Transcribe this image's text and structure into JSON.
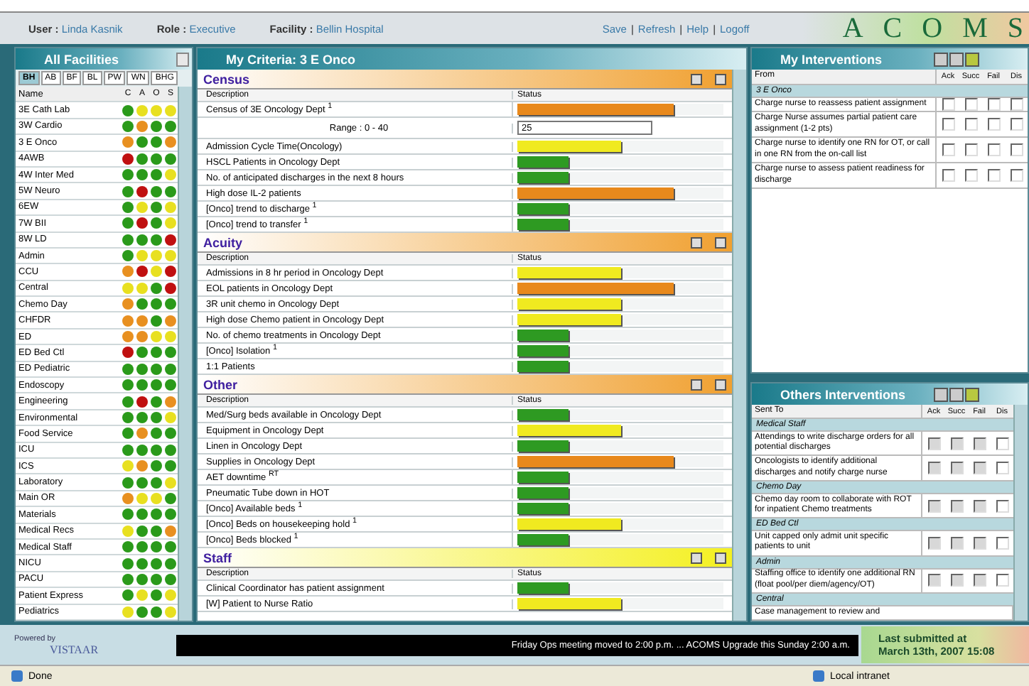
{
  "header": {
    "user_label": "User :",
    "user": "Linda Kasnik",
    "role_label": "Role :",
    "role": "Executive",
    "facility_label": "Facility :",
    "facility": "Bellin Hospital",
    "links": [
      "Save",
      "Refresh",
      "Help",
      "Logoff"
    ],
    "separator": "|",
    "logo": [
      "A",
      "C",
      "O",
      "M",
      "S"
    ]
  },
  "facilities": {
    "title": "All Facilities",
    "tabs": [
      {
        "label": "BH",
        "selected": true
      },
      {
        "label": "AB",
        "selected": false
      },
      {
        "label": "BF",
        "selected": false
      },
      {
        "label": "BL",
        "selected": false
      },
      {
        "label": "PW",
        "selected": false
      },
      {
        "label": "WN",
        "selected": false
      },
      {
        "label": "BHG",
        "selected": false
      }
    ],
    "columns": [
      "Name",
      "C",
      "A",
      "O",
      "S"
    ],
    "rows": [
      {
        "name": "3E Cath Lab",
        "lights": [
          {
            "color": "#2a9a1a"
          },
          {
            "color": "#e8e020"
          },
          {
            "color": "#e8e020"
          },
          {
            "color": "#e8e020"
          }
        ]
      },
      {
        "name": "3W Cardio",
        "lights": [
          {
            "color": "#2a9a1a"
          },
          {
            "color": "#e89020"
          },
          {
            "color": "#2a9a1a"
          },
          {
            "color": "#2a9a1a"
          }
        ]
      },
      {
        "name": "3 E Onco",
        "lights": [
          {
            "color": "#e89020"
          },
          {
            "color": "#2a9a1a"
          },
          {
            "color": "#2a9a1a"
          },
          {
            "color": "#e89020"
          }
        ]
      },
      {
        "name": "4AWB",
        "lights": [
          {
            "color": "#c01010"
          },
          {
            "color": "#2a9a1a"
          },
          {
            "color": "#2a9a1a"
          },
          {
            "color": "#2a9a1a"
          }
        ]
      },
      {
        "name": "4W Inter Med",
        "lights": [
          {
            "color": "#2a9a1a"
          },
          {
            "color": "#2a9a1a"
          },
          {
            "color": "#2a9a1a"
          },
          {
            "color": "#e8e020"
          }
        ]
      },
      {
        "name": "5W Neuro",
        "lights": [
          {
            "color": "#2a9a1a"
          },
          {
            "color": "#c01010"
          },
          {
            "color": "#2a9a1a"
          },
          {
            "color": "#2a9a1a"
          }
        ]
      },
      {
        "name": "6EW",
        "lights": [
          {
            "color": "#2a9a1a"
          },
          {
            "color": "#e8e020"
          },
          {
            "color": "#2a9a1a"
          },
          {
            "color": "#e8e020"
          }
        ]
      },
      {
        "name": "7W BII",
        "lights": [
          {
            "color": "#2a9a1a"
          },
          {
            "color": "#c01010"
          },
          {
            "color": "#2a9a1a"
          },
          {
            "color": "#e8e020"
          }
        ]
      },
      {
        "name": "8W LD",
        "lights": [
          {
            "color": "#2a9a1a"
          },
          {
            "color": "#2a9a1a"
          },
          {
            "color": "#2a9a1a"
          },
          {
            "color": "#c01010"
          }
        ]
      },
      {
        "name": "Admin",
        "lights": [
          {
            "color": "#2a9a1a"
          },
          {
            "color": "#e8e020"
          },
          {
            "color": "#e8e020"
          },
          {
            "color": "#e8e020"
          }
        ]
      },
      {
        "name": "CCU",
        "lights": [
          {
            "color": "#e89020"
          },
          {
            "color": "#c01010"
          },
          {
            "color": "#e8e020"
          },
          {
            "color": "#c01010"
          }
        ]
      },
      {
        "name": "Central",
        "lights": [
          {
            "color": "#e8e020"
          },
          {
            "color": "#e8e020"
          },
          {
            "color": "#2a9a1a"
          },
          {
            "color": "#c01010"
          }
        ]
      },
      {
        "name": "Chemo Day",
        "lights": [
          {
            "color": "#e89020"
          },
          {
            "color": "#2a9a1a"
          },
          {
            "color": "#2a9a1a"
          },
          {
            "color": "#2a9a1a"
          }
        ]
      },
      {
        "name": "CHFDR",
        "lights": [
          {
            "color": "#e89020"
          },
          {
            "color": "#e89020"
          },
          {
            "color": "#2a9a1a"
          },
          {
            "color": "#e89020"
          }
        ]
      },
      {
        "name": "ED",
        "lights": [
          {
            "color": "#e89020"
          },
          {
            "color": "#e89020"
          },
          {
            "color": "#e8e020"
          },
          {
            "color": "#e8e020"
          }
        ]
      },
      {
        "name": "ED Bed Ctl",
        "lights": [
          {
            "color": "#c01010"
          },
          {
            "color": "#2a9a1a"
          },
          {
            "color": "#2a9a1a"
          },
          {
            "color": "#2a9a1a"
          }
        ]
      },
      {
        "name": "ED Pediatric",
        "lights": [
          {
            "color": "#2a9a1a"
          },
          {
            "color": "#2a9a1a"
          },
          {
            "color": "#2a9a1a"
          },
          {
            "color": "#2a9a1a"
          }
        ]
      },
      {
        "name": "Endoscopy",
        "lights": [
          {
            "color": "#2a9a1a"
          },
          {
            "color": "#2a9a1a"
          },
          {
            "color": "#2a9a1a"
          },
          {
            "color": "#2a9a1a"
          }
        ]
      },
      {
        "name": "Engineering",
        "lights": [
          {
            "color": "#2a9a1a"
          },
          {
            "color": "#c01010"
          },
          {
            "color": "#2a9a1a"
          },
          {
            "color": "#e89020"
          }
        ]
      },
      {
        "name": "Environmental",
        "lights": [
          {
            "color": "#2a9a1a"
          },
          {
            "color": "#2a9a1a"
          },
          {
            "color": "#2a9a1a"
          },
          {
            "color": "#e8e020"
          }
        ]
      },
      {
        "name": "Food Service",
        "lights": [
          {
            "color": "#2a9a1a"
          },
          {
            "color": "#e89020"
          },
          {
            "color": "#2a9a1a"
          },
          {
            "color": "#2a9a1a"
          }
        ]
      },
      {
        "name": "ICU",
        "lights": [
          {
            "color": "#2a9a1a"
          },
          {
            "color": "#2a9a1a"
          },
          {
            "color": "#2a9a1a"
          },
          {
            "color": "#2a9a1a"
          }
        ]
      },
      {
        "name": "ICS",
        "lights": [
          {
            "color": "#e8e020"
          },
          {
            "color": "#e89020"
          },
          {
            "color": "#2a9a1a"
          },
          {
            "color": "#2a9a1a"
          }
        ]
      },
      {
        "name": "Laboratory",
        "lights": [
          {
            "color": "#2a9a1a"
          },
          {
            "color": "#2a9a1a"
          },
          {
            "color": "#2a9a1a"
          },
          {
            "color": "#e8e020"
          }
        ]
      },
      {
        "name": "Main OR",
        "lights": [
          {
            "color": "#e89020"
          },
          {
            "color": "#e8e020"
          },
          {
            "color": "#e8e020"
          },
          {
            "color": "#2a9a1a"
          }
        ]
      },
      {
        "name": "Materials",
        "lights": [
          {
            "color": "#2a9a1a"
          },
          {
            "color": "#2a9a1a"
          },
          {
            "color": "#2a9a1a"
          },
          {
            "color": "#2a9a1a"
          }
        ]
      },
      {
        "name": "Medical Recs",
        "lights": [
          {
            "color": "#e8e020"
          },
          {
            "color": "#2a9a1a"
          },
          {
            "color": "#2a9a1a"
          },
          {
            "color": "#e89020"
          }
        ]
      },
      {
        "name": "Medical Staff",
        "lights": [
          {
            "color": "#2a9a1a"
          },
          {
            "color": "#2a9a1a"
          },
          {
            "color": "#2a9a1a"
          },
          {
            "color": "#2a9a1a"
          }
        ]
      },
      {
        "name": "NICU",
        "lights": [
          {
            "color": "#2a9a1a"
          },
          {
            "color": "#2a9a1a"
          },
          {
            "color": "#2a9a1a"
          },
          {
            "color": "#2a9a1a"
          }
        ]
      },
      {
        "name": "PACU",
        "lights": [
          {
            "color": "#2a9a1a"
          },
          {
            "color": "#2a9a1a"
          },
          {
            "color": "#2a9a1a"
          },
          {
            "color": "#2a9a1a"
          }
        ]
      },
      {
        "name": "Patient Express",
        "lights": [
          {
            "color": "#2a9a1a"
          },
          {
            "color": "#e8e020"
          },
          {
            "color": "#2a9a1a"
          },
          {
            "color": "#e8e020"
          }
        ]
      },
      {
        "name": "Pediatrics",
        "lights": [
          {
            "color": "#e8e020"
          },
          {
            "color": "#2a9a1a"
          },
          {
            "color": "#2a9a1a"
          },
          {
            "color": "#e8e020"
          }
        ]
      }
    ]
  },
  "criteria": {
    "title": "My Criteria: 3 E Onco",
    "sections": [
      {
        "name": "Census",
        "color": "#f0a030",
        "columns": [
          "Description",
          "Status"
        ],
        "rows": [
          {
            "kind": "bar",
            "label": "Census of 3E Oncology Dept $^{1}$",
            "level": 0.76,
            "color": "#e8891c"
          },
          {
            "kind": "range",
            "label": "Range : 0 - 40",
            "value": "25"
          },
          {
            "kind": "bar",
            "label": "Admission Cycle Time(Oncology)",
            "level": 0.5,
            "color": "#f0ea20"
          },
          {
            "kind": "bar",
            "label": "HSCL Patients in Oncology Dept",
            "level": 0.25,
            "color": "#2e9a22"
          },
          {
            "kind": "bar",
            "label": "No. of anticipated discharges in the next 8 hours",
            "level": 0.25,
            "color": "#2e9a22"
          },
          {
            "kind": "bar",
            "label": "High dose IL-2 patients",
            "level": 0.76,
            "color": "#e8891c"
          },
          {
            "kind": "bar",
            "label": "[Onco] trend to discharge $^{1}$",
            "level": 0.25,
            "color": "#2e9a22"
          },
          {
            "kind": "bar",
            "label": "[Onco] trend to transfer $^{1}$",
            "level": 0.25,
            "color": "#2e9a22"
          }
        ]
      },
      {
        "name": "Acuity",
        "color": "#f0a030",
        "columns": [
          "Description",
          "Status"
        ],
        "rows": [
          {
            "kind": "bar",
            "label": "Admissions in 8 hr period in Oncology Dept",
            "level": 0.5,
            "color": "#f0ea20"
          },
          {
            "kind": "bar",
            "label": "EOL patients in Oncology Dept",
            "level": 0.76,
            "color": "#e8891c"
          },
          {
            "kind": "bar",
            "label": "3R unit chemo in Oncology Dept",
            "level": 0.5,
            "color": "#f0ea20"
          },
          {
            "kind": "bar",
            "label": "High dose Chemo patient in Oncology Dept",
            "level": 0.5,
            "color": "#f0ea20"
          },
          {
            "kind": "bar",
            "label": "No. of chemo treatments in Oncology Dept",
            "level": 0.25,
            "color": "#2e9a22"
          },
          {
            "kind": "bar",
            "label": "[Onco] Isolation $^{1}$",
            "level": 0.25,
            "color": "#2e9a22"
          },
          {
            "kind": "bar",
            "label": "1:1 Patients",
            "level": 0.25,
            "color": "#2e9a22"
          }
        ]
      },
      {
        "name": "Other",
        "color": "#f0a030",
        "columns": [
          "Description",
          "Status"
        ],
        "rows": [
          {
            "kind": "bar",
            "label": "Med/Surg beds available in Oncology Dept",
            "level": 0.25,
            "color": "#2e9a22"
          },
          {
            "kind": "bar",
            "label": "Equipment in Oncology Dept",
            "level": 0.5,
            "color": "#f0ea20"
          },
          {
            "kind": "bar",
            "label": "Linen in Oncology Dept",
            "level": 0.25,
            "color": "#2e9a22"
          },
          {
            "kind": "bar",
            "label": "Supplies in Oncology Dept",
            "level": 0.76,
            "color": "#e8891c"
          },
          {
            "kind": "bar",
            "label": "AET downtime $^{RT}$",
            "level": 0.25,
            "color": "#2e9a22"
          },
          {
            "kind": "bar",
            "label": "Pneumatic Tube down in HOT",
            "level": 0.25,
            "color": "#2e9a22"
          },
          {
            "kind": "bar",
            "label": "[Onco] Available beds $^{1}$",
            "level": 0.25,
            "color": "#2e9a22"
          },
          {
            "kind": "bar",
            "label": "[Onco] Beds on housekeeping hold $^{1}$",
            "level": 0.5,
            "color": "#f0ea20"
          },
          {
            "kind": "bar",
            "label": "[Onco] Beds blocked $^{1}$",
            "level": 0.25,
            "color": "#2e9a22"
          }
        ]
      },
      {
        "name": "Staff",
        "color": "#f4f020",
        "columns": [
          "Description",
          "Status"
        ],
        "rows": [
          {
            "kind": "bar",
            "label": "Clinical Coordinator has patient assignment",
            "level": 0.25,
            "color": "#2e9a22"
          },
          {
            "kind": "bar",
            "label": "[W] Patient to Nurse Ratio",
            "level": 0.5,
            "color": "#f0ea20"
          }
        ]
      }
    ]
  },
  "my_interventions": {
    "title": "My Interventions",
    "columns": [
      "From",
      "Ack",
      "Succ",
      "Fail",
      "Dis"
    ],
    "groups": [
      {
        "name": "3 E Onco",
        "rows": [
          {
            "text": "Charge nurse to reassess patient assignment",
            "checks": [
              {
                "checked": false,
                "disabled": false
              },
              {
                "checked": false,
                "disabled": false
              },
              {
                "checked": false,
                "disabled": false
              },
              {
                "checked": false,
                "disabled": false
              }
            ]
          },
          {
            "text": "Charge Nurse assumes partial patient care assignment (1-2 pts)",
            "checks": [
              {
                "checked": false,
                "disabled": false
              },
              {
                "checked": false,
                "disabled": false
              },
              {
                "checked": false,
                "disabled": false
              },
              {
                "checked": false,
                "disabled": false
              }
            ]
          },
          {
            "text": "Charge nurse to identify one RN for OT, or call in one RN from the on-call list",
            "checks": [
              {
                "checked": false,
                "disabled": false
              },
              {
                "checked": false,
                "disabled": false
              },
              {
                "checked": false,
                "disabled": false
              },
              {
                "checked": false,
                "disabled": false
              }
            ]
          },
          {
            "text": "Charge nurse to assess patient readiness for discharge",
            "checks": [
              {
                "checked": false,
                "disabled": false
              },
              {
                "checked": false,
                "disabled": false
              },
              {
                "checked": false,
                "disabled": false
              },
              {
                "checked": false,
                "disabled": false
              }
            ]
          }
        ]
      }
    ]
  },
  "others_interventions": {
    "title": "Others Interventions",
    "columns": [
      "Sent To",
      "Ack",
      "Succ",
      "Fail",
      "Dis"
    ],
    "groups": [
      {
        "name": "Medical Staff",
        "rows": [
          {
            "text": "Attendings to write discharge orders for all potential discharges",
            "checks": [
              {
                "checked": false,
                "disabled": true
              },
              {
                "checked": false,
                "disabled": true
              },
              {
                "checked": false,
                "disabled": true
              },
              {
                "checked": false,
                "disabled": false
              }
            ]
          },
          {
            "text": "Oncologists to identify additional discharges and notify charge nurse",
            "checks": [
              {
                "checked": false,
                "disabled": true
              },
              {
                "checked": false,
                "disabled": true
              },
              {
                "checked": false,
                "disabled": true
              },
              {
                "checked": false,
                "disabled": false
              }
            ]
          }
        ]
      },
      {
        "name": "Chemo Day",
        "rows": [
          {
            "text": "Chemo day room to collaborate with ROT for inpatient Chemo treatments",
            "checks": [
              {
                "checked": false,
                "disabled": true
              },
              {
                "checked": false,
                "disabled": true
              },
              {
                "checked": false,
                "disabled": true
              },
              {
                "checked": false,
                "disabled": false
              }
            ]
          }
        ]
      },
      {
        "name": "ED Bed Ctl",
        "rows": [
          {
            "text": "Unit capped only admit unit specific patients to unit",
            "checks": [
              {
                "checked": false,
                "disabled": true
              },
              {
                "checked": false,
                "disabled": true
              },
              {
                "checked": false,
                "disabled": true
              },
              {
                "checked": false,
                "disabled": false
              }
            ]
          }
        ]
      },
      {
        "name": "Admin",
        "rows": [
          {
            "text": "Staffing office to identify one additional RN (float pool/per diem/agency/OT)",
            "checks": [
              {
                "checked": false,
                "disabled": true
              },
              {
                "checked": false,
                "disabled": true
              },
              {
                "checked": false,
                "disabled": true
              },
              {
                "checked": false,
                "disabled": false
              }
            ]
          }
        ]
      },
      {
        "name": "Central",
        "rows": [
          {
            "text": "Case management to review and",
            "checks": []
          }
        ]
      }
    ]
  },
  "footer": {
    "powered_by": "Powered by",
    "vendor": "VISTAAR",
    "ticker": "Friday Ops meeting moved to 2:00 p.m. ... ACOMS Upgrade this Sunday 2:00 a.m.",
    "last_submitted": "Last submitted at",
    "last_submitted_time": "March 13th, 2007 15:08"
  },
  "status_bar": {
    "status": "Done",
    "zone": "Local intranet"
  }
}
